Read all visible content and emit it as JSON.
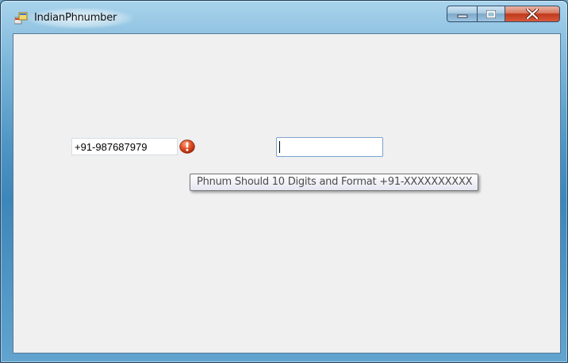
{
  "window": {
    "title": "IndianPhnumber"
  },
  "form": {
    "phone_value": "+91-987687979",
    "second_value": ""
  },
  "validation": {
    "tooltip_text": "Phnum Should 10 Digits and Format +91-XXXXXXXXXX",
    "icon": "error-icon",
    "icon_color": "#d9431c"
  },
  "icons": {
    "app": "app-icon",
    "minimize": "minimize-icon",
    "maximize": "maximize-icon",
    "close": "close-icon"
  }
}
